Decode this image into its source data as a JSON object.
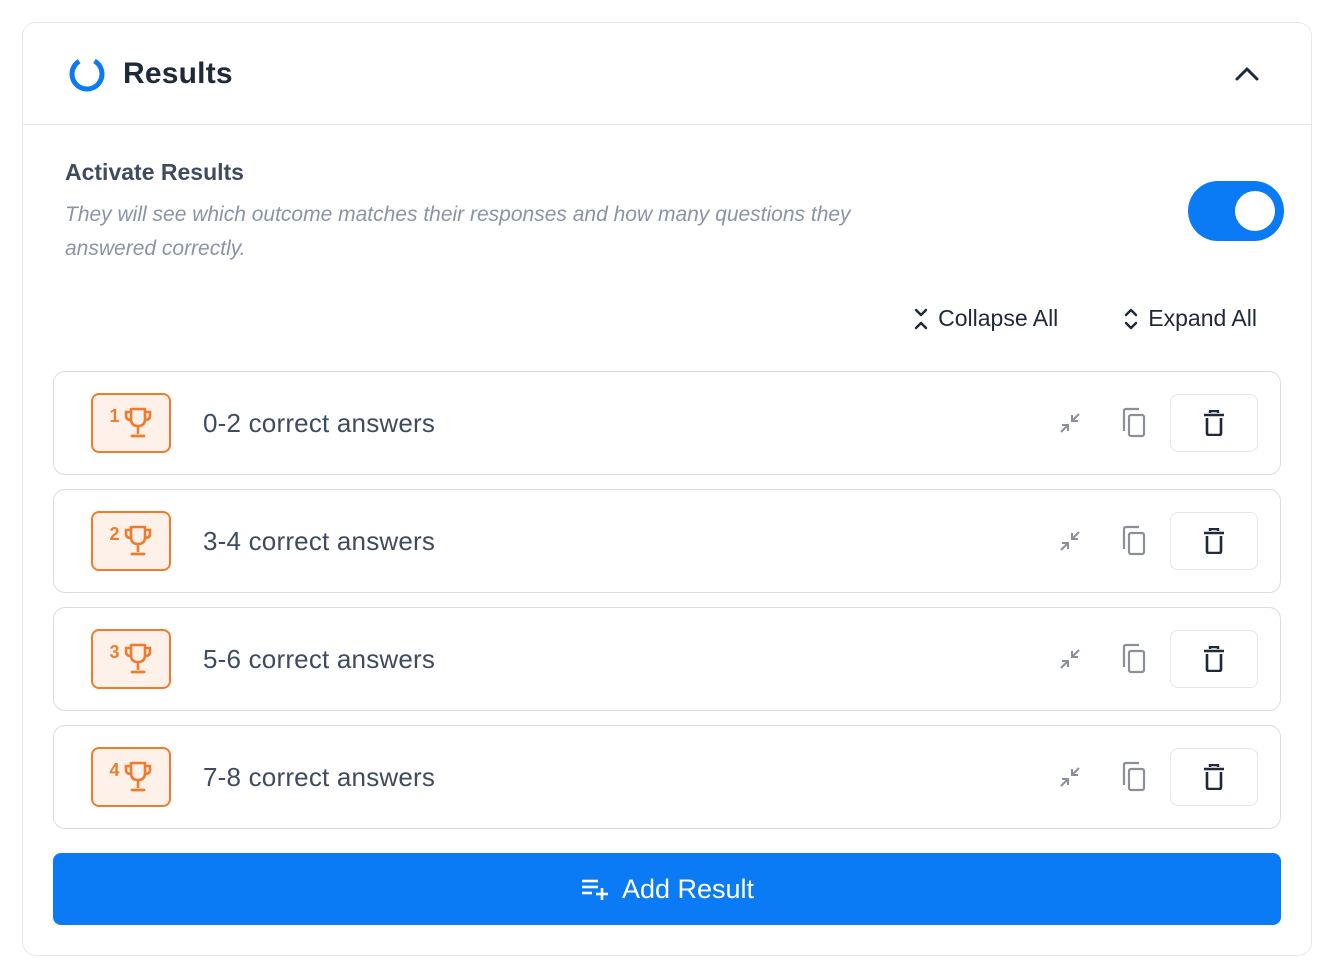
{
  "header": {
    "title": "Results",
    "icon": "results-ring-icon",
    "toggle_icon": "chevron-up-icon"
  },
  "activate": {
    "label": "Activate Results",
    "description": "They will see which outcome matches their responses and how many questions they answered correctly.",
    "enabled": true
  },
  "bulk_actions": {
    "collapse_label": "Collapse All",
    "expand_label": "Expand All"
  },
  "results": [
    {
      "index": "1",
      "title": "0-2 correct answers"
    },
    {
      "index": "2",
      "title": "3-4 correct answers"
    },
    {
      "index": "3",
      "title": "5-6 correct answers"
    },
    {
      "index": "4",
      "title": "7-8 correct answers"
    }
  ],
  "add_button": {
    "label": "Add Result",
    "icon": "playlist-add-icon"
  },
  "colors": {
    "accent": "#0b7bf5",
    "badge": "#f07b2c",
    "badge_bg": "#fdf1ea"
  }
}
